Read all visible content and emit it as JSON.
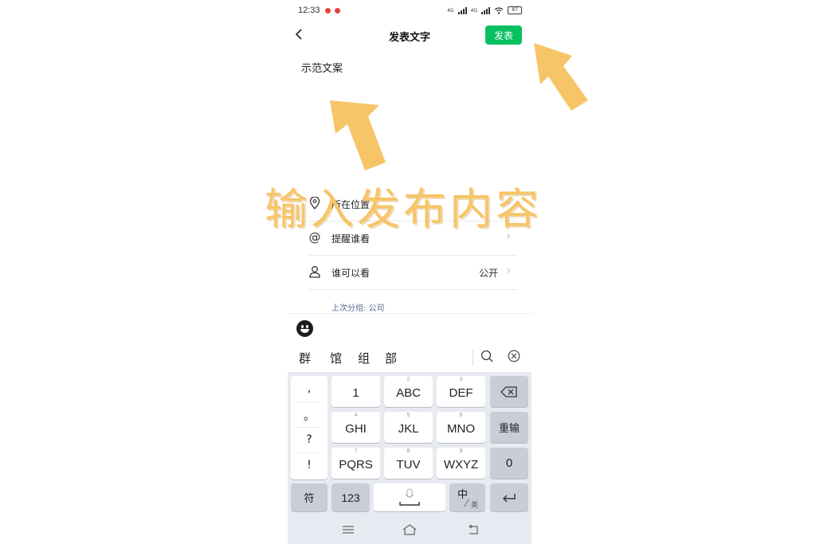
{
  "status_bar": {
    "time": "12:33",
    "battery": "87",
    "network_1": "4G",
    "network_2": "4G"
  },
  "nav": {
    "back_icon": "chevron-left-icon",
    "title": "发表文字",
    "publish_label": "发表"
  },
  "compose": {
    "text": "示范文案"
  },
  "options": [
    {
      "icon": "location-icon",
      "label": "所在位置",
      "value": ""
    },
    {
      "icon": "at-icon",
      "label": "提醒谁看",
      "value": ""
    },
    {
      "icon": "person-icon",
      "label": "谁可以看",
      "value": "公开"
    }
  ],
  "last_group": "上次分组: 公司",
  "candidates": [
    "群",
    "馆",
    "组",
    "部"
  ],
  "keyboard": {
    "punct": [
      ",",
      "。",
      "?",
      "!"
    ],
    "rows": [
      [
        {
          "label": "1",
          "sub": ""
        },
        {
          "label": "ABC",
          "sub": "2"
        },
        {
          "label": "DEF",
          "sub": "3"
        }
      ],
      [
        {
          "label": "GHI",
          "sub": "4"
        },
        {
          "label": "JKL",
          "sub": "5"
        },
        {
          "label": "MNO",
          "sub": "6"
        }
      ],
      [
        {
          "label": "PQRS",
          "sub": "7"
        },
        {
          "label": "TUV",
          "sub": "8"
        },
        {
          "label": "WXYZ",
          "sub": "9"
        }
      ]
    ],
    "reinput": "重输",
    "zero": "0",
    "symbol": "符",
    "num_mode": "123",
    "lang_main": "中",
    "lang_sub": "英"
  },
  "overlay": {
    "caption": "输入发布内容",
    "color": "#f6c568"
  },
  "colors": {
    "accent": "#07c160",
    "keyboard_bg": "#e8eaf1",
    "dark_key": "#c9cdd8",
    "link": "#57698a"
  }
}
